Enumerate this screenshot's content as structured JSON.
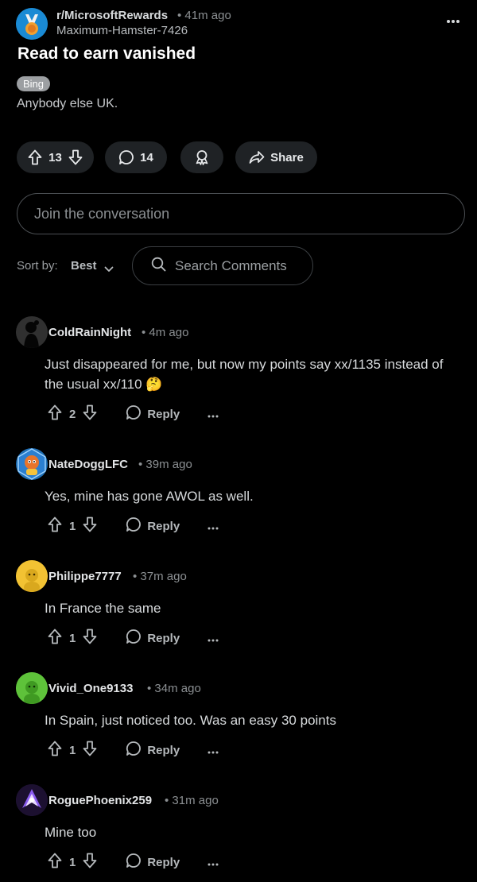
{
  "post": {
    "subreddit": "r/MicrosoftRewards",
    "time": "• 41m ago",
    "author": "Maximum-Hamster-7426",
    "title": "Read to earn vanished",
    "flair": "Bing",
    "body": "Anybody else UK.",
    "upvotes": "13",
    "comments": "14",
    "share_label": "Share"
  },
  "composer": {
    "placeholder": "Join the conversation"
  },
  "sort": {
    "label": "Sort by:",
    "value": "Best",
    "search_placeholder": "Search Comments"
  },
  "comments": [
    {
      "user": "ColdRainNight",
      "time": "• 4m ago",
      "text": "Just disappeared for me, but now my points say xx/1135 instead of the usual xx/110 🤔",
      "score": "2",
      "reply": "Reply"
    },
    {
      "user": "NateDoggLFC",
      "time": "• 39m ago",
      "text": "Yes, mine has gone AWOL as well.",
      "score": "1",
      "reply": "Reply"
    },
    {
      "user": "Philippe7777",
      "time": "• 37m ago",
      "text": "In France the same",
      "score": "1",
      "reply": "Reply"
    },
    {
      "user": "Vivid_One9133",
      "time": "• 34m ago",
      "text": "In Spain, just noticed too. Was an easy 30 points",
      "score": "1",
      "reply": "Reply"
    },
    {
      "user": "RoguePhoenix259",
      "time": "• 31m ago",
      "text": "Mine too",
      "score": "1",
      "reply": "Reply"
    }
  ],
  "icons": {
    "more": "ellipsis-icon",
    "upvote": "arrow-up-icon",
    "downvote": "arrow-down-icon",
    "comment": "speech-bubble-icon",
    "award": "award-icon",
    "share": "share-arrow-icon",
    "search": "search-icon",
    "sort": "chevron-down-icon"
  },
  "colors": {
    "background": "#000000",
    "pill": "#1f2225",
    "flair": "#9c9fa2",
    "subreddit_avatar": "#1a8ad4"
  }
}
